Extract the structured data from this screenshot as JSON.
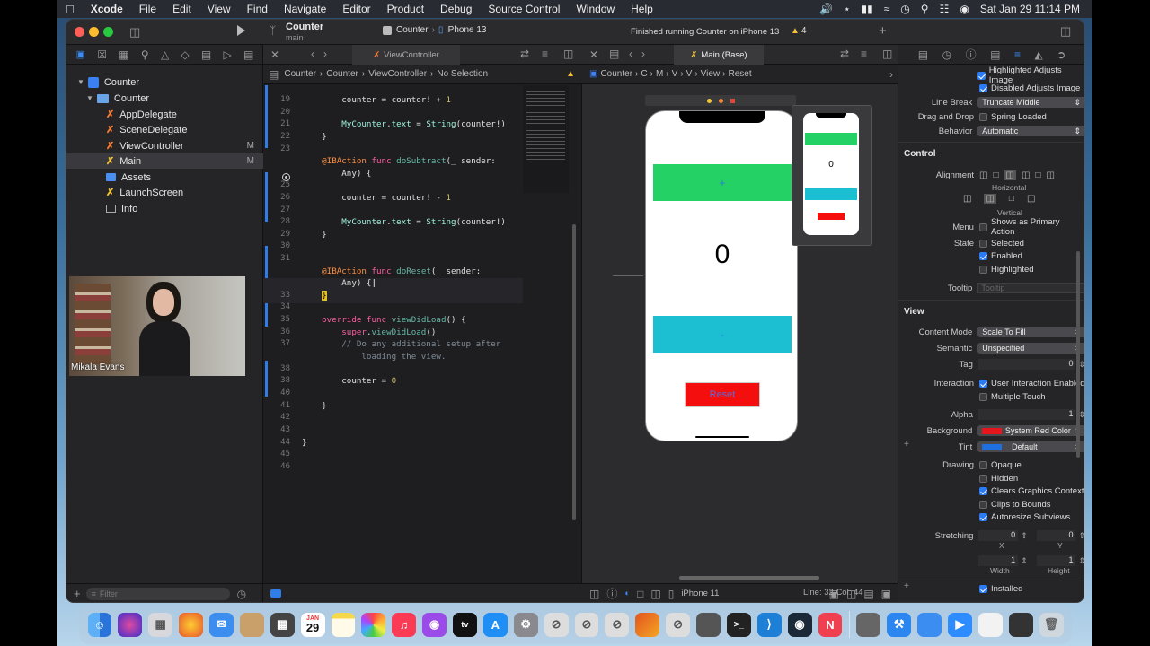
{
  "menubar": {
    "apple": "",
    "items": [
      "Xcode",
      "File",
      "Edit",
      "View",
      "Find",
      "Navigate",
      "Editor",
      "Product",
      "Debug",
      "Source Control",
      "Window",
      "Help"
    ],
    "datetime": "Sat Jan 29  11:14 PM"
  },
  "toolbar": {
    "project": "Counter",
    "branch": "main",
    "scheme": "Counter",
    "device": "iPhone 13",
    "status": "Finished running Counter on iPhone 13",
    "warnings": "4"
  },
  "navigator": {
    "items": [
      {
        "label": "Counter",
        "icon": "project-icon",
        "badge": ""
      },
      {
        "label": "Counter",
        "icon": "folder-icon",
        "badge": ""
      },
      {
        "label": "AppDelegate",
        "icon": "swift-icon",
        "badge": ""
      },
      {
        "label": "SceneDelegate",
        "icon": "swift-icon",
        "badge": ""
      },
      {
        "label": "ViewController",
        "icon": "swift-icon",
        "badge": "M"
      },
      {
        "label": "Main",
        "icon": "storyboard-icon",
        "badge": "M"
      },
      {
        "label": "Assets",
        "icon": "assets-icon",
        "badge": ""
      },
      {
        "label": "LaunchScreen",
        "icon": "storyboard-icon",
        "badge": ""
      },
      {
        "label": "Info",
        "icon": "plist-icon",
        "badge": ""
      }
    ],
    "filter_placeholder": "Filter"
  },
  "editor": {
    "tab": "ViewController",
    "jumpbar": [
      "Counter",
      "Counter",
      "ViewController",
      "No Selection"
    ],
    "lines": [
      {
        "n": "19",
        "t": "        counter = counter! + 1"
      },
      {
        "n": "20",
        "t": ""
      },
      {
        "n": "21",
        "t": "        MyCounter.text = String(counter!)"
      },
      {
        "n": "22",
        "t": "    }"
      },
      {
        "n": "23",
        "t": ""
      },
      {
        "n": "",
        "t": "    @IBAction func doSubtract(_ sender:"
      },
      {
        "n": "",
        "t": "        Any) {"
      },
      {
        "n": "25",
        "t": ""
      },
      {
        "n": "26",
        "t": "        counter = counter! - 1"
      },
      {
        "n": "27",
        "t": ""
      },
      {
        "n": "28",
        "t": "        MyCounter.text = String(counter!)"
      },
      {
        "n": "29",
        "t": "    }"
      },
      {
        "n": "30",
        "t": ""
      },
      {
        "n": "31",
        "t": ""
      },
      {
        "n": "",
        "t": "    @IBAction func doReset(_ sender:"
      },
      {
        "n": "",
        "t": "        Any) {"
      },
      {
        "n": "33",
        "t": "    }"
      },
      {
        "n": "34",
        "t": ""
      },
      {
        "n": "35",
        "t": "    override func viewDidLoad() {"
      },
      {
        "n": "36",
        "t": "        super.viewDidLoad()"
      },
      {
        "n": "37",
        "t": "        // Do any additional setup after"
      },
      {
        "n": "",
        "t": "            loading the view."
      },
      {
        "n": "38",
        "t": "        counter = 0"
      },
      {
        "n": "40",
        "t": ""
      },
      {
        "n": "41",
        "t": "    }"
      },
      {
        "n": "42",
        "t": ""
      },
      {
        "n": "43",
        "t": ""
      },
      {
        "n": "44",
        "t": "}"
      },
      {
        "n": "45",
        "t": ""
      },
      {
        "n": "46",
        "t": ""
      }
    ]
  },
  "canvas": {
    "tab": "Main (Base)",
    "jumpbar": [
      "Counter",
      "C",
      "M",
      "V",
      "V",
      "View",
      "Reset"
    ],
    "plus_label": "+",
    "counter_label": "0",
    "minus_label": "-",
    "reset_label": "Reset",
    "device": "iPhone 11",
    "mini_counter": "0"
  },
  "video": {
    "name": "Mikala Evans"
  },
  "statusbar": {
    "position": "Line: 32  Col: 44"
  },
  "inspector": {
    "rows_top": [
      {
        "type": "check",
        "on": true,
        "label": "Highlighted Adjusts Image"
      },
      {
        "type": "check",
        "on": true,
        "label": "Disabled Adjusts Image"
      },
      {
        "type": "pop",
        "key": "Line Break",
        "value": "Truncate Middle"
      },
      {
        "type": "check",
        "on": false,
        "key": "Drag and Drop",
        "label": "Spring Loaded"
      },
      {
        "type": "pop",
        "key": "Behavior",
        "value": "Automatic"
      }
    ],
    "control_title": "Control",
    "alignment_label": "Alignment",
    "horizontal_label": "Horizontal",
    "vertical_label": "Vertical",
    "menu_key": "Menu",
    "menu_label": "Shows as Primary Action",
    "state_key": "State",
    "state_items": [
      {
        "on": false,
        "label": "Selected"
      },
      {
        "on": true,
        "label": "Enabled"
      },
      {
        "on": false,
        "label": "Highlighted"
      }
    ],
    "tooltip_key": "Tooltip",
    "tooltip_placeholder": "Tooltip",
    "view_title": "View",
    "content_mode_key": "Content Mode",
    "content_mode": "Scale To Fill",
    "semantic_key": "Semantic",
    "semantic": "Unspecified",
    "tag_key": "Tag",
    "tag": "0",
    "interaction_key": "Interaction",
    "interaction_items": [
      {
        "on": true,
        "label": "User Interaction Enabled"
      },
      {
        "on": false,
        "label": "Multiple Touch"
      }
    ],
    "alpha_key": "Alpha",
    "alpha": "1",
    "background_key": "Background",
    "background": "System Red Color",
    "background_color": "#e8141c",
    "tint_key": "Tint",
    "tint": "Default",
    "tint_color": "#1e6fe0",
    "drawing_key": "Drawing",
    "drawing_items": [
      {
        "on": false,
        "label": "Opaque"
      },
      {
        "on": false,
        "label": "Hidden"
      },
      {
        "on": true,
        "label": "Clears Graphics Context"
      },
      {
        "on": false,
        "label": "Clips to Bounds"
      },
      {
        "on": true,
        "label": "Autoresize Subviews"
      }
    ],
    "stretching_key": "Stretching",
    "stretch_x": "0",
    "stretch_y": "0",
    "x_label": "X",
    "y_label": "Y",
    "stretch_w": "1",
    "stretch_h": "1",
    "width_label": "Width",
    "height_label": "Height",
    "installed_label": "Installed"
  },
  "dock": {
    "calendar_month": "JAN",
    "calendar_day": "29",
    "apps": [
      "finder",
      "siri",
      "launchpad",
      "firefox",
      "mail",
      "contacts",
      "calculator",
      "calendar",
      "notes",
      "photos",
      "music",
      "podcasts",
      "tv",
      "appstore",
      "settings",
      "block",
      "block",
      "block",
      "matlab",
      "block",
      "mac",
      "terminal",
      "vscode",
      "steam",
      "news",
      "printer",
      "xcode",
      "sim",
      "zoom",
      "preview",
      "display",
      "trash"
    ]
  }
}
